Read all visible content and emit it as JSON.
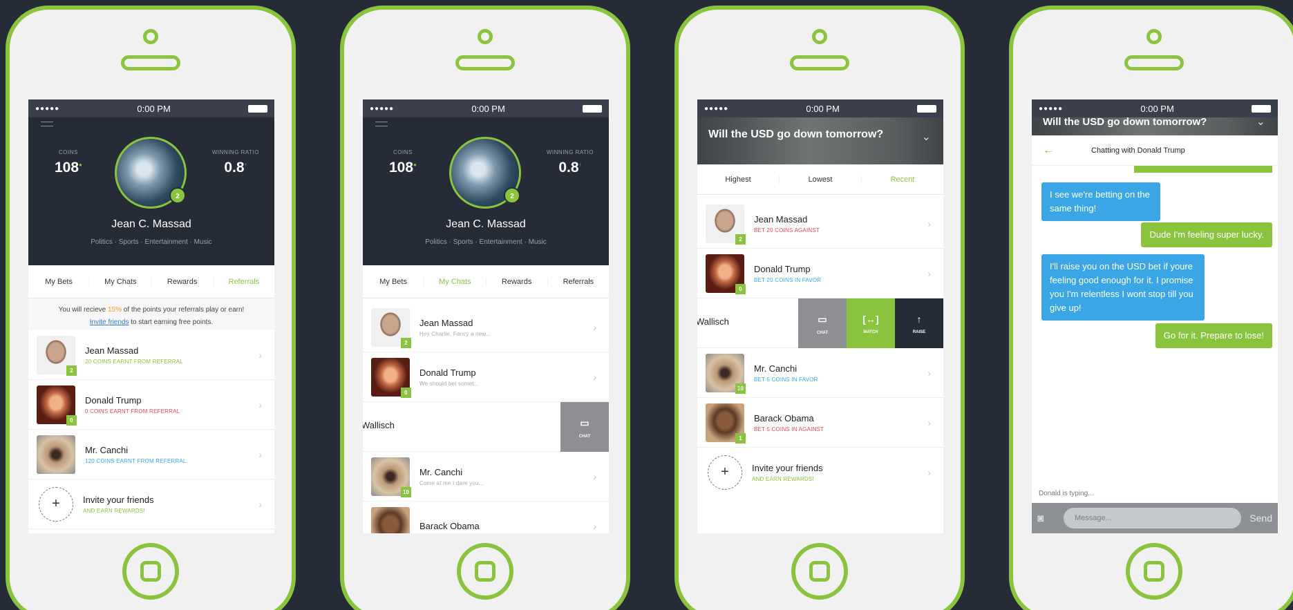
{
  "status": {
    "dots": "●●●●●",
    "time": "0:00 PM"
  },
  "profile": {
    "coins_label": "COINS",
    "coins": "108",
    "ratio_label": "WINNING RATIO",
    "ratio": "0.8",
    "level": "2",
    "name": "Jean C. Massad",
    "tags": "Politics · Sports · Entertainment · Music"
  },
  "tabs": [
    "My Bets",
    "My Chats",
    "Rewards",
    "Referrals"
  ],
  "screen1": {
    "notice_pre": "You will recieve ",
    "notice_pct": "15%",
    "notice_post": " of the points your referrals play or earn!",
    "invite_link": "Invite friends",
    "invite_post": " to start earning free points.",
    "rows": [
      {
        "name": "Jean Massad",
        "sub": "20 COINS EARNT FROM REFERRAL",
        "badge": "2"
      },
      {
        "name": "Donald Trump",
        "sub": "0 COINS EARNT FROM REFERRAL",
        "badge": "0"
      },
      {
        "name": "Mr. Canchi",
        "sub": "120 COINS EARNT FROM REFERRAL",
        "badge": ""
      }
    ],
    "invite": {
      "name": "Invite your friends",
      "sub": "AND EARN REWARDS!"
    }
  },
  "screen2": {
    "rows": [
      {
        "name": "Jean Massad",
        "sub": "Hey Charlie, Fancy a new...",
        "badge": "2"
      },
      {
        "name": "Donald Trump",
        "sub": "We should bet somet...",
        "badge": "0"
      }
    ],
    "swipe_name": "Wallisch",
    "swipe_action": "CHAT",
    "rows2": [
      {
        "name": "Mr. Canchi",
        "sub": "Come at me I dare you...",
        "badge": "10"
      },
      {
        "name": "Barack Obama",
        "sub": "",
        "badge": ""
      }
    ]
  },
  "screen3": {
    "question": "Will the USD go down tomorrow?",
    "sorts": [
      "Highest",
      "Lowest",
      "Recent"
    ],
    "rows": [
      {
        "name": "Jean Massad",
        "sub": "BET 20 COINS AGAINST",
        "badge": "2"
      },
      {
        "name": "Donald Trump",
        "sub": "BET 20 COINS IN FAVOR",
        "badge": "0"
      }
    ],
    "swipe_name": "Wallisch",
    "actions": [
      "CHAT",
      "MATCH",
      "RAISE"
    ],
    "rows2": [
      {
        "name": "Mr. Canchi",
        "sub": "BET 5 COINS IN FAVOR",
        "badge": "10"
      },
      {
        "name": "Barack Obama",
        "sub": "BET 5 COINS IN AGAINST",
        "badge": "1"
      }
    ],
    "invite": {
      "name": "Invite your friends",
      "sub": "AND EARN REWARDS!"
    }
  },
  "screen4": {
    "question": "Will the USD go down tomorrow?",
    "title": "Chatting with Donald Trump",
    "messages": [
      "I see we're betting on the same thing!",
      "Dude I'm feeling super lucky.",
      "I'll raise you on the USD bet if youre feeling good enough for it. I promise you I'm relentless I wont stop till you give up!",
      "Go for it. Prepare to lose!"
    ],
    "typing": "Donald is typing...",
    "placeholder": "Message...",
    "send": "Send"
  },
  "colors": {
    "accent": "#8ac43f",
    "dark": "#262b38",
    "blue": "#3aa6e6",
    "red": "#e8484a"
  }
}
